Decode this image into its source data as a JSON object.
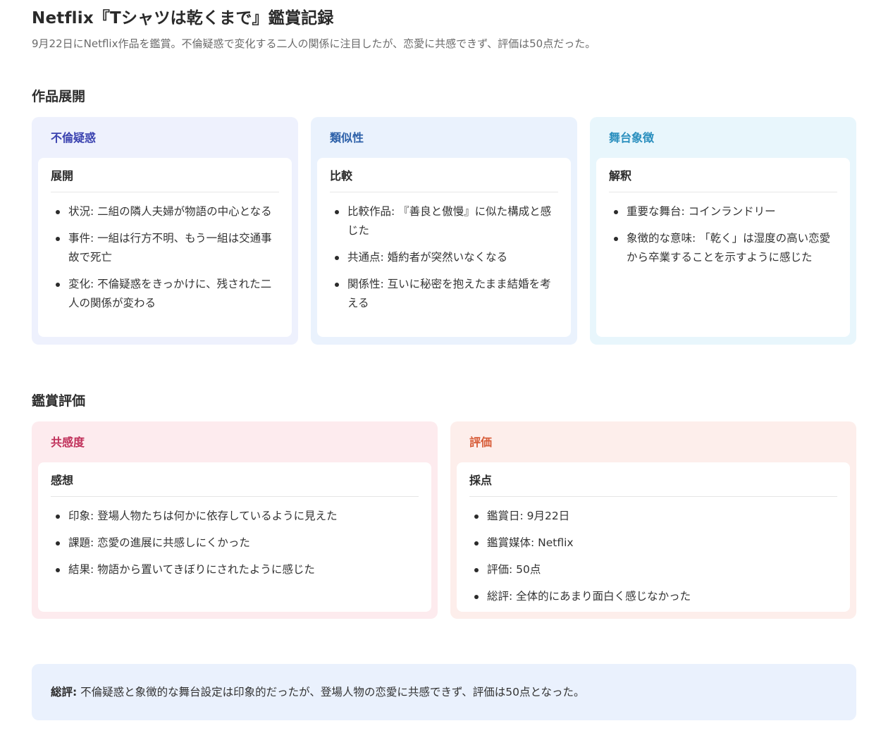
{
  "header": {
    "title": "Netflix『Tシャツは乾くまで』鑑賞記録",
    "subtitle": "9月22日にNetflix作品を鑑賞。不倫疑惑で変化する二人の関係に注目したが、恋愛に共感できず、評価は50点だった。"
  },
  "sections": {
    "development": {
      "title": "作品展開",
      "cards": [
        {
          "head": "不倫疑惑",
          "body_title": "展開",
          "items": [
            "状況: 二組の隣人夫婦が物語の中心となる",
            "事件: 一組は行方不明、もう一組は交通事故で死亡",
            "変化: 不倫疑惑をきっかけに、残された二人の関係が変わる"
          ]
        },
        {
          "head": "類似性",
          "body_title": "比較",
          "items": [
            "比較作品: 『善良と傲慢』に似た構成と感じた",
            "共通点: 婚約者が突然いなくなる",
            "関係性: 互いに秘密を抱えたまま結婚を考える"
          ]
        },
        {
          "head": "舞台象徴",
          "body_title": "解釈",
          "items": [
            "重要な舞台: コインランドリー",
            "象徴的な意味: 「乾く」は湿度の高い恋愛から卒業することを示すように感じた"
          ]
        }
      ]
    },
    "evaluation": {
      "title": "鑑賞評価",
      "cards": [
        {
          "head": "共感度",
          "body_title": "感想",
          "items": [
            "印象: 登場人物たちは何かに依存しているように見えた",
            "課題: 恋愛の進展に共感しにくかった",
            "結果: 物語から置いてきぼりにされたように感じた"
          ]
        },
        {
          "head": "評価",
          "body_title": "採点",
          "items": [
            "鑑賞日: 9月22日",
            "鑑賞媒体: Netflix",
            "評価: 50点",
            "総評: 全体的にあまり面白く感じなかった"
          ]
        }
      ]
    }
  },
  "summary": {
    "label": "総評:",
    "text": "不倫疑惑と象徴的な舞台設定は印象的だったが、登場人物の恋愛に共感できず、評価は50点となった。"
  },
  "colors": {
    "card1_bg": "#eef1fd",
    "card1_head": "#3b43b0",
    "card2_bg": "#eaf2fd",
    "card2_head": "#2b5fa8",
    "card3_bg": "#e8f6fc",
    "card3_head": "#2a8fbe",
    "card4_bg": "#fdebee",
    "card4_head": "#c0305a",
    "card5_bg": "#fdeeeb",
    "card5_head": "#d75c38"
  }
}
